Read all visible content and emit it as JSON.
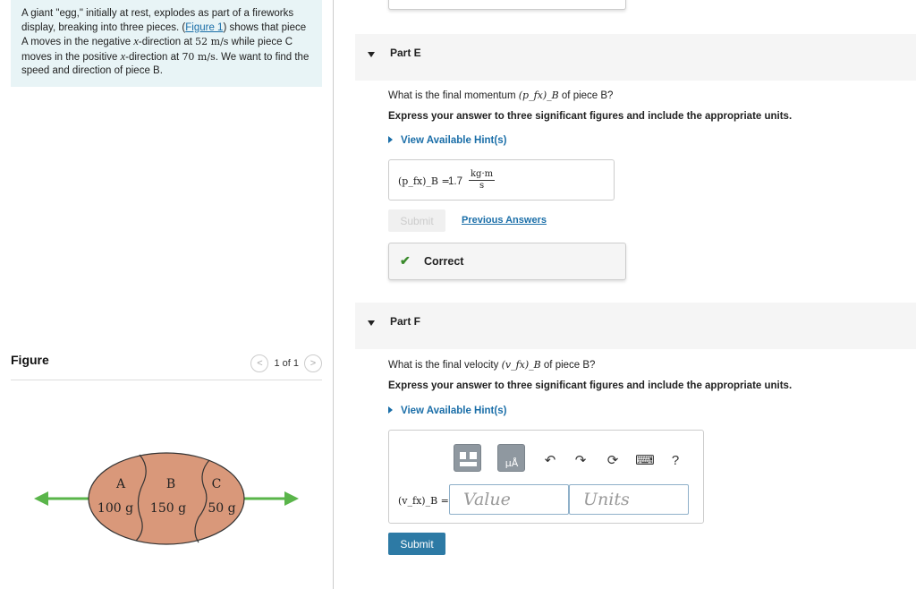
{
  "problem": {
    "text_1": "A giant \"egg,\" initially at rest, explodes as part of a fireworks display, breaking into three pieces. (",
    "figure_link": "Figure 1",
    "text_2": ") shows that piece A moves in the negative ",
    "x_1": "x",
    "text_3": "-direction at ",
    "speed_a": "52 m/s",
    "text_4": " while piece C moves in the positive ",
    "x_2": "x",
    "text_5": "-direction at ",
    "speed_c": "70 m/s",
    "text_6": ". We want to find the speed and direction of piece B."
  },
  "figure": {
    "title": "Figure",
    "prev": "<",
    "next": ">",
    "counter": "1 of 1",
    "labels": [
      "A",
      "B",
      "C"
    ],
    "masses": [
      "100 g",
      "150 g",
      "50 g"
    ],
    "arrow_color": "#5ab54a",
    "egg_color": "#d9987a"
  },
  "part_e": {
    "label": "Part E",
    "question_pre": "What is the final momentum ",
    "question_var": "(p_fx)_B",
    "question_post": " of piece B?",
    "instruction": "Express your answer to three significant figures and include the appropriate units.",
    "hint": "View Available Hint(s)",
    "answer_var": "(p_fx)_B =",
    "answer_value": "1.7",
    "unit_num": "kg·m",
    "unit_den": "s",
    "submit": "Submit",
    "previous_answers": "Previous Answers",
    "feedback": "Correct"
  },
  "part_f": {
    "label": "Part F",
    "question_pre": "What is the final velocity ",
    "question_var": "(v_fx)_B",
    "question_post": " of piece B?",
    "instruction": "Express your answer to three significant figures and include the appropriate units.",
    "hint": "View Available Hint(s)",
    "answer_var": "(v_fx)_B =",
    "value_placeholder": "Value",
    "units_placeholder": "Units",
    "submit": "Submit",
    "toolbar_help": "?"
  },
  "colors": {
    "accent": "#2d7aa5",
    "link": "#1a6ea8",
    "correct": "#3a8a2c",
    "problem_bg": "#e8f4f6"
  }
}
